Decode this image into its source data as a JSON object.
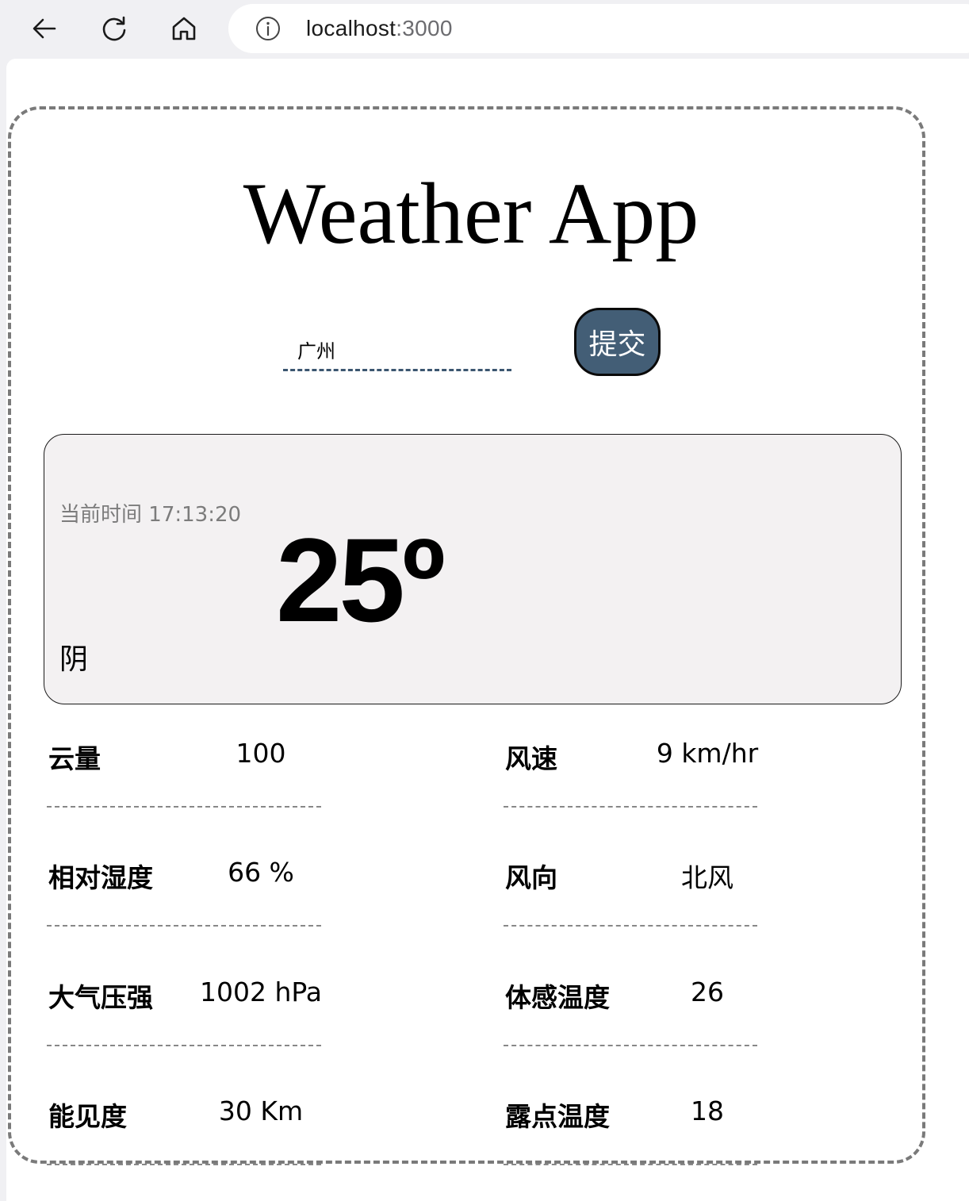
{
  "browser": {
    "url_host": "localhost",
    "url_port": ":3000",
    "icons": [
      "back-icon",
      "reload-icon",
      "home-icon",
      "info-icon"
    ]
  },
  "app": {
    "title": "Weather App",
    "city_input_value": "广州",
    "submit_label": "提交"
  },
  "current": {
    "time_label": "当前时间",
    "time": "17:13:20",
    "temperature": "25º",
    "condition": "阴"
  },
  "stats": {
    "left": [
      {
        "label": "云量",
        "value": "100"
      },
      {
        "label": "相对湿度",
        "value": "66 %"
      },
      {
        "label": "大气压强",
        "value": "1002 hPa"
      },
      {
        "label": "能见度",
        "value": "30 Km"
      }
    ],
    "right": [
      {
        "label": "风速",
        "value": "9 km/hr"
      },
      {
        "label": "风向",
        "value": "北风"
      },
      {
        "label": "体感温度",
        "value": "26"
      },
      {
        "label": "露点温度",
        "value": "18"
      }
    ]
  },
  "colors": {
    "button_bg": "#435e76",
    "panel_bg": "#f3f1f2",
    "card_border": "#7a7a7a",
    "input_underline": "#3b5670"
  }
}
